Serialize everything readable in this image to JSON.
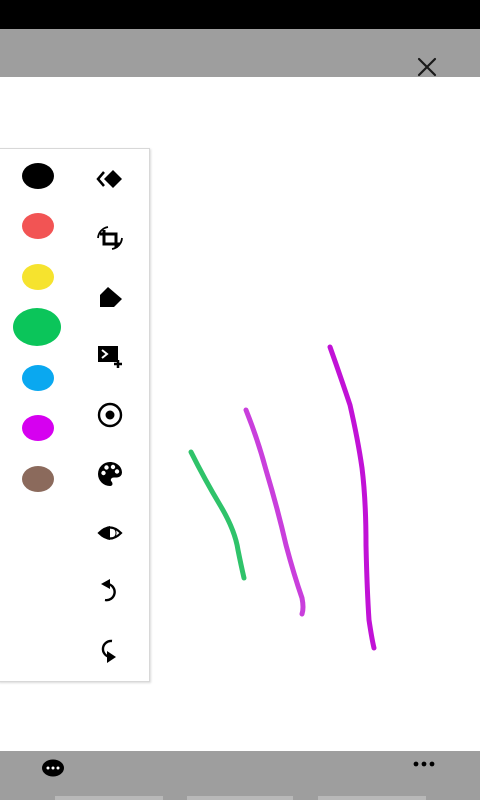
{
  "palette": {
    "colors": [
      {
        "name": "black",
        "hex": "#000000"
      },
      {
        "name": "red",
        "hex": "#f25454"
      },
      {
        "name": "yellow",
        "hex": "#f6e32e"
      },
      {
        "name": "green",
        "hex": "#0bc55a",
        "selected": true
      },
      {
        "name": "blue",
        "hex": "#0aa8f0"
      },
      {
        "name": "purple",
        "hex": "#d600f0"
      },
      {
        "name": "brown",
        "hex": "#8b6a5c"
      }
    ]
  },
  "tools": [
    {
      "icon": "collapse-panel-icon"
    },
    {
      "icon": "rotate-crop-icon"
    },
    {
      "icon": "eraser-icon"
    },
    {
      "icon": "add-frame-icon"
    },
    {
      "icon": "brush-size-icon"
    },
    {
      "icon": "palette-icon"
    },
    {
      "icon": "opacity-icon"
    },
    {
      "icon": "undo-icon"
    },
    {
      "icon": "redo-icon"
    }
  ],
  "strokes": [
    {
      "color": "#2fc36a"
    },
    {
      "color": "#c93fdc"
    },
    {
      "color": "#c112d6"
    }
  ],
  "top_bar": {
    "close_icon": "close-icon"
  },
  "bottom_bar": {
    "left_icon": "chat-icon",
    "right_icon": "more-icon"
  }
}
